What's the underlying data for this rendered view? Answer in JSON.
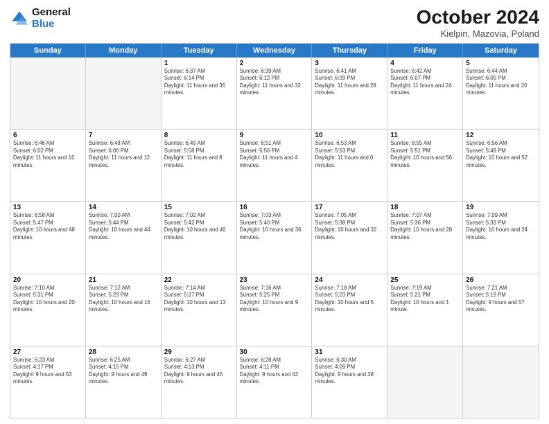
{
  "header": {
    "logo_general": "General",
    "logo_blue": "Blue",
    "month": "October 2024",
    "location": "Kielpin, Mazovia, Poland"
  },
  "weekdays": [
    "Sunday",
    "Monday",
    "Tuesday",
    "Wednesday",
    "Thursday",
    "Friday",
    "Saturday"
  ],
  "rows": [
    [
      {
        "day": "",
        "text": ""
      },
      {
        "day": "",
        "text": ""
      },
      {
        "day": "1",
        "text": "Sunrise: 6:37 AM\nSunset: 6:14 PM\nDaylight: 11 hours and 36 minutes."
      },
      {
        "day": "2",
        "text": "Sunrise: 6:39 AM\nSunset: 6:12 PM\nDaylight: 11 hours and 32 minutes."
      },
      {
        "day": "3",
        "text": "Sunrise: 6:41 AM\nSunset: 6:09 PM\nDaylight: 11 hours and 28 minutes."
      },
      {
        "day": "4",
        "text": "Sunrise: 6:42 AM\nSunset: 6:07 PM\nDaylight: 11 hours and 24 minutes."
      },
      {
        "day": "5",
        "text": "Sunrise: 6:44 AM\nSunset: 6:05 PM\nDaylight: 11 hours and 20 minutes."
      }
    ],
    [
      {
        "day": "6",
        "text": "Sunrise: 6:46 AM\nSunset: 6:02 PM\nDaylight: 11 hours and 16 minutes."
      },
      {
        "day": "7",
        "text": "Sunrise: 6:48 AM\nSunset: 6:00 PM\nDaylight: 11 hours and 12 minutes."
      },
      {
        "day": "8",
        "text": "Sunrise: 6:49 AM\nSunset: 5:58 PM\nDaylight: 11 hours and 8 minutes."
      },
      {
        "day": "9",
        "text": "Sunrise: 6:51 AM\nSunset: 5:56 PM\nDaylight: 11 hours and 4 minutes."
      },
      {
        "day": "10",
        "text": "Sunrise: 6:53 AM\nSunset: 5:53 PM\nDaylight: 11 hours and 0 minutes."
      },
      {
        "day": "11",
        "text": "Sunrise: 6:55 AM\nSunset: 5:51 PM\nDaylight: 10 hours and 56 minutes."
      },
      {
        "day": "12",
        "text": "Sunrise: 6:56 AM\nSunset: 5:49 PM\nDaylight: 10 hours and 52 minutes."
      }
    ],
    [
      {
        "day": "13",
        "text": "Sunrise: 6:58 AM\nSunset: 5:47 PM\nDaylight: 10 hours and 48 minutes."
      },
      {
        "day": "14",
        "text": "Sunrise: 7:00 AM\nSunset: 5:44 PM\nDaylight: 10 hours and 44 minutes."
      },
      {
        "day": "15",
        "text": "Sunrise: 7:02 AM\nSunset: 5:42 PM\nDaylight: 10 hours and 40 minutes."
      },
      {
        "day": "16",
        "text": "Sunrise: 7:03 AM\nSunset: 5:40 PM\nDaylight: 10 hours and 36 minutes."
      },
      {
        "day": "17",
        "text": "Sunrise: 7:05 AM\nSunset: 5:38 PM\nDaylight: 10 hours and 32 minutes."
      },
      {
        "day": "18",
        "text": "Sunrise: 7:07 AM\nSunset: 5:36 PM\nDaylight: 10 hours and 28 minutes."
      },
      {
        "day": "19",
        "text": "Sunrise: 7:09 AM\nSunset: 5:33 PM\nDaylight: 10 hours and 24 minutes."
      }
    ],
    [
      {
        "day": "20",
        "text": "Sunrise: 7:10 AM\nSunset: 5:31 PM\nDaylight: 10 hours and 20 minutes."
      },
      {
        "day": "21",
        "text": "Sunrise: 7:12 AM\nSunset: 5:29 PM\nDaylight: 10 hours and 16 minutes."
      },
      {
        "day": "22",
        "text": "Sunrise: 7:14 AM\nSunset: 5:27 PM\nDaylight: 10 hours and 13 minutes."
      },
      {
        "day": "23",
        "text": "Sunrise: 7:16 AM\nSunset: 5:25 PM\nDaylight: 10 hours and 9 minutes."
      },
      {
        "day": "24",
        "text": "Sunrise: 7:18 AM\nSunset: 5:23 PM\nDaylight: 10 hours and 5 minutes."
      },
      {
        "day": "25",
        "text": "Sunrise: 7:19 AM\nSunset: 5:21 PM\nDaylight: 10 hours and 1 minute."
      },
      {
        "day": "26",
        "text": "Sunrise: 7:21 AM\nSunset: 5:19 PM\nDaylight: 9 hours and 57 minutes."
      }
    ],
    [
      {
        "day": "27",
        "text": "Sunrise: 6:23 AM\nSunset: 4:17 PM\nDaylight: 9 hours and 53 minutes."
      },
      {
        "day": "28",
        "text": "Sunrise: 6:25 AM\nSunset: 4:15 PM\nDaylight: 9 hours and 49 minutes."
      },
      {
        "day": "29",
        "text": "Sunrise: 6:27 AM\nSunset: 4:13 PM\nDaylight: 9 hours and 46 minutes."
      },
      {
        "day": "30",
        "text": "Sunrise: 6:28 AM\nSunset: 4:11 PM\nDaylight: 9 hours and 42 minutes."
      },
      {
        "day": "31",
        "text": "Sunrise: 6:30 AM\nSunset: 4:09 PM\nDaylight: 9 hours and 38 minutes."
      },
      {
        "day": "",
        "text": ""
      },
      {
        "day": "",
        "text": ""
      }
    ]
  ]
}
